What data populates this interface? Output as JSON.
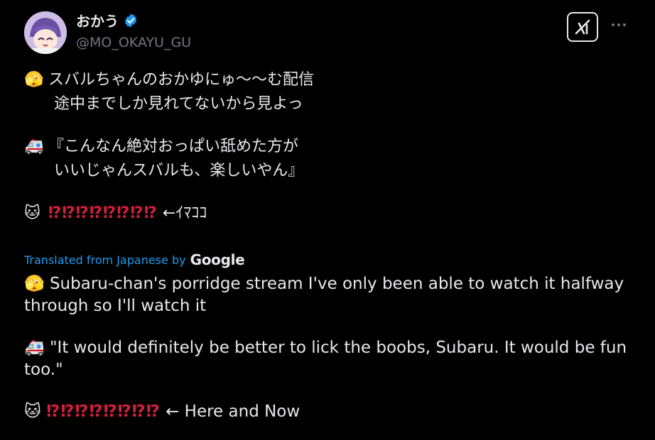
{
  "author": {
    "display_name": "おかう",
    "handle": "@MO_OKAYU_GU",
    "verified": true
  },
  "header_actions": {
    "grok_icon": "grok-icon",
    "more_icon": "more-dots-icon"
  },
  "original": {
    "line1_emoji": "🫣",
    "line1_text": "スバルちゃんのおかゆにゅ〜〜む配信",
    "line2_text": "途中までしか見れてないから見よっ",
    "line3_emoji": "🚑",
    "line3_text": "『こんなん絶対おっぱい舐めた方が",
    "line4_text": "いいじゃんスバルも、楽しいやん』",
    "line5_emoji": "🐱",
    "line5_marks": "⁉⁉⁉⁉⁉⁉⁉⁉",
    "line5_text": " ←ｲﾏｺｺ"
  },
  "translation_label": {
    "prefix": "Translated from Japanese by",
    "provider": "Google"
  },
  "translation": {
    "para1_emoji": "🫣",
    "para1_text": "Subaru-chan's porridge stream I've only been able to watch it halfway through so I'll watch it",
    "para2_emoji": "🚑",
    "para2_text": "\"It would definitely be better to lick the boobs, Subaru. It would be fun too.\"",
    "para3_emoji": "🐱",
    "para3_marks": "⁉⁉⁉⁉⁉⁉⁉⁉",
    "para3_text": " ← Here and Now"
  },
  "colors": {
    "background": "#000000",
    "text": "#e7e9ea",
    "secondary": "#71767b",
    "link": "#1d9bf0",
    "verified": "#1d9bf0",
    "marks": "#d41f3b"
  }
}
